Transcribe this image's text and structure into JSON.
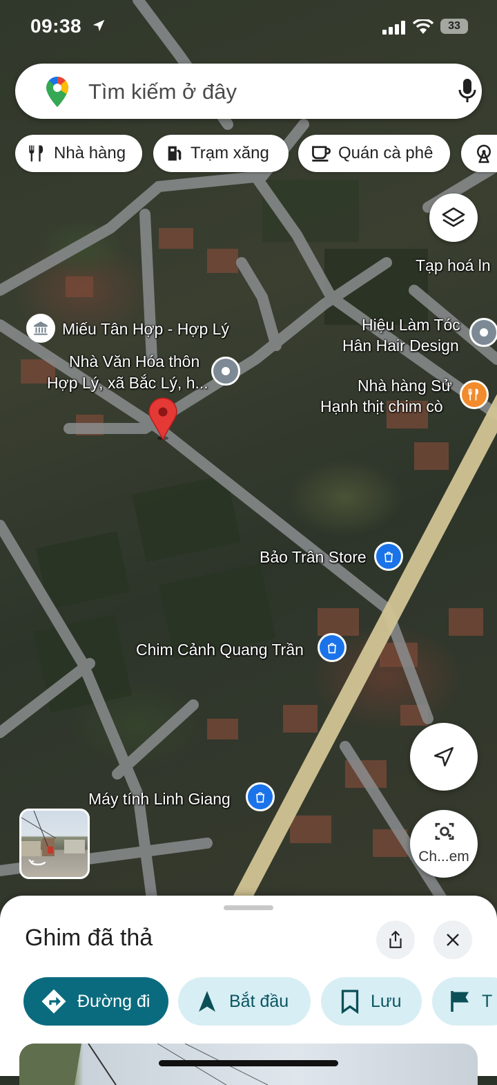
{
  "status_bar": {
    "time": "09:38",
    "battery": "33"
  },
  "search": {
    "placeholder": "Tìm kiếm ở đây"
  },
  "chips": [
    {
      "label": "Nhà hàng",
      "icon": "fork-knife-icon"
    },
    {
      "label": "Trạm xăng",
      "icon": "gas-station-icon"
    },
    {
      "label": "Quán cà phê",
      "icon": "coffee-cup-icon"
    },
    {
      "label": "",
      "icon": "ferris-wheel-icon"
    }
  ],
  "map": {
    "places": [
      {
        "name": "Tạp hoá ln",
        "type": "label"
      },
      {
        "name": "Miếu Tân Hợp - Hợp Lý",
        "type": "temple"
      },
      {
        "name": "Hiệu Làm Tóc",
        "name2": "Hân Hair Design",
        "type": "gray-pin"
      },
      {
        "name": "Nhà Văn Hóa thôn",
        "name2": "Hợp Lý, xã Bắc Lý, h...",
        "type": "gray-pin"
      },
      {
        "name": "Nhà hàng Sử",
        "name2": "Hạnh thịt chim cò",
        "type": "restaurant"
      },
      {
        "name": "Bảo Trân Store",
        "type": "shopping"
      },
      {
        "name": "Chim Cảnh Quang Trần",
        "type": "shopping"
      },
      {
        "name": "Máy tính Linh Giang",
        "type": "shopping"
      }
    ],
    "lens_label": "Ch...em"
  },
  "sheet": {
    "title": "Ghim đã thả",
    "actions": [
      {
        "label": "Đường đi",
        "icon": "directions-icon"
      },
      {
        "label": "Bắt đầu",
        "icon": "navigation-arrow-icon"
      },
      {
        "label": "Lưu",
        "icon": "bookmark-icon"
      },
      {
        "label": "T",
        "icon": "flag-icon"
      }
    ]
  },
  "colors": {
    "accent": "#0b6b7e",
    "secondary_bg": "#d7eef4",
    "pin_red": "#e53935"
  }
}
